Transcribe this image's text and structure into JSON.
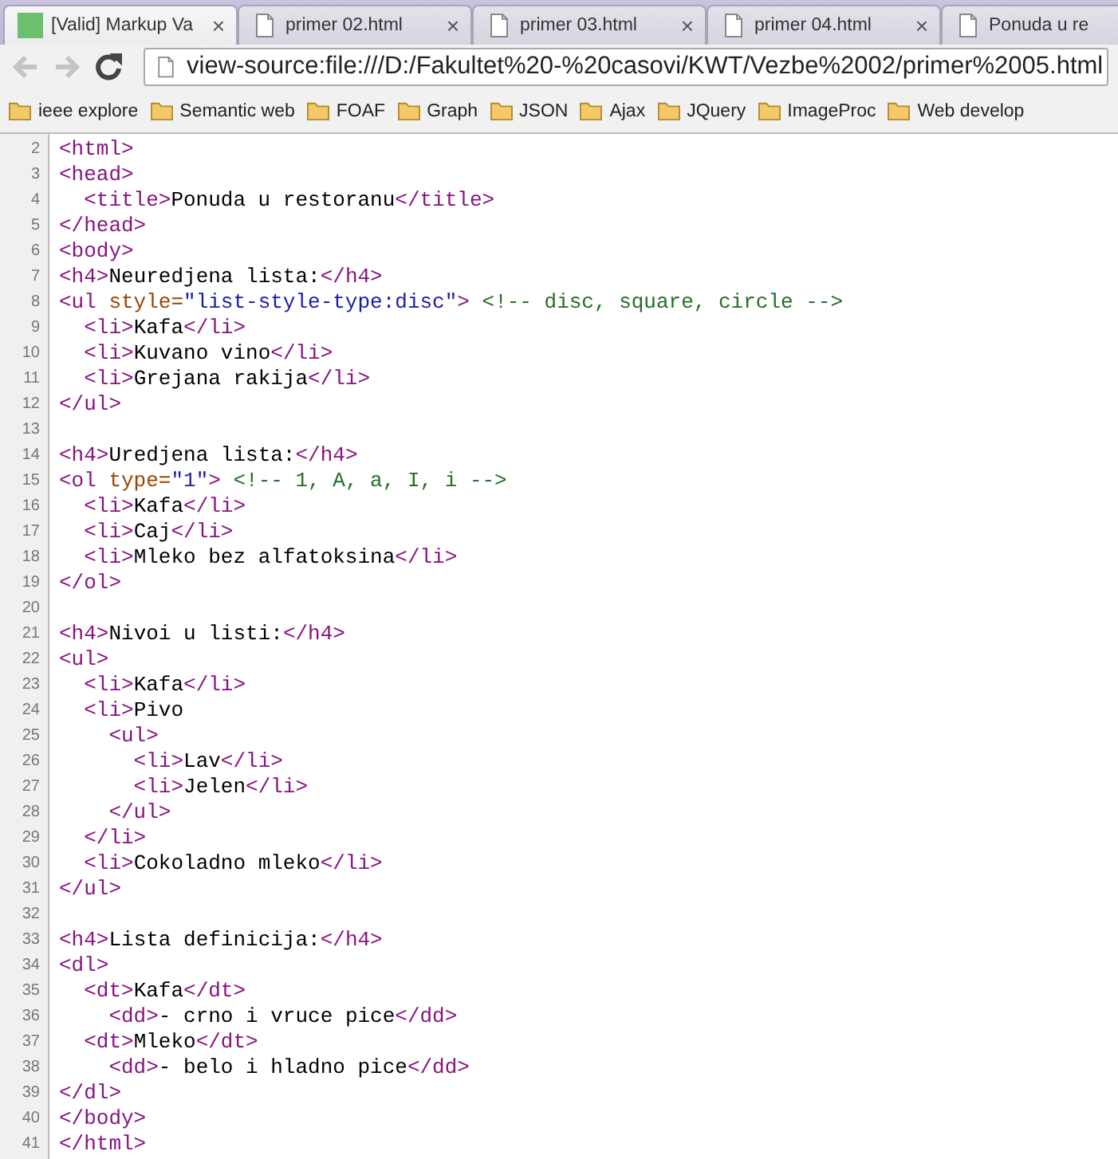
{
  "tabs": [
    {
      "title": "[Valid] Markup Va",
      "kind": "site",
      "close": "×",
      "selected": true
    },
    {
      "title": "primer 02.html",
      "kind": "file",
      "close": "×",
      "selected": false
    },
    {
      "title": "primer 03.html",
      "kind": "file",
      "close": "×",
      "selected": false
    },
    {
      "title": "primer 04.html",
      "kind": "file",
      "close": "×",
      "selected": false
    },
    {
      "title": "Ponuda u re",
      "kind": "file",
      "selected": false
    }
  ],
  "toolbar": {
    "address": "view-source:file:///D:/Fakultet%20-%20casovi/KWT/Vezbe%2002/primer%2005.html",
    "back_disabled": true,
    "forward_disabled": true
  },
  "bookmarks": [
    "ieee explore",
    "Semantic web",
    "FOAF",
    "Graph",
    "JSON",
    "Ajax",
    "JQuery",
    "ImageProc",
    "Web develop"
  ],
  "source_lines": [
    {
      "number": "2",
      "tokens": [
        {
          "kind": "tag",
          "text": "<html>"
        }
      ]
    },
    {
      "number": "3",
      "tokens": [
        {
          "kind": "tag",
          "text": "<head>"
        }
      ]
    },
    {
      "number": "4",
      "kind": "indented",
      "tokens": [
        {
          "kind": "tag",
          "text": "<title>"
        },
        {
          "kind": "text",
          "text": "Ponuda u restoranu"
        },
        {
          "kind": "tag",
          "text": "</title>"
        }
      ]
    },
    {
      "number": "5",
      "tokens": [
        {
          "kind": "tag",
          "text": "</head>"
        }
      ]
    },
    {
      "number": "6",
      "tokens": [
        {
          "kind": "tag",
          "text": "<body>"
        }
      ]
    },
    {
      "number": "7",
      "tokens": [
        {
          "kind": "tag",
          "text": "<h4>"
        },
        {
          "kind": "text",
          "text": "Neuredjena lista:"
        },
        {
          "kind": "tag",
          "text": "</h4>"
        }
      ]
    },
    {
      "number": "8",
      "tokens": [
        {
          "kind": "tag",
          "text": "<ul"
        },
        {
          "kind": "attr",
          "text": "style="
        },
        {
          "kind": "value",
          "text": "\"list-style-type:disc\""
        },
        {
          "kind": "tag",
          "text": ">"
        },
        {
          "kind": "comment",
          "text": "<!-- disc, square, circle -->"
        }
      ]
    },
    {
      "number": "9",
      "kind": "indented",
      "tokens": [
        {
          "kind": "tag",
          "text": "<li>"
        },
        {
          "kind": "text",
          "text": "Kafa"
        },
        {
          "kind": "tag",
          "text": "</li>"
        }
      ]
    },
    {
      "number": "10",
      "kind": "indented",
      "tokens": [
        {
          "kind": "tag",
          "text": "<li>"
        },
        {
          "kind": "text",
          "text": "Kuvano vino"
        },
        {
          "kind": "tag",
          "text": "</li>"
        }
      ]
    },
    {
      "number": "11",
      "kind": "indented",
      "tokens": [
        {
          "kind": "tag",
          "text": "<li>"
        },
        {
          "kind": "text",
          "text": "Grejana rakija"
        },
        {
          "kind": "tag",
          "text": "</li>"
        }
      ]
    },
    {
      "number": "12",
      "tokens": [
        {
          "kind": "tag",
          "text": "</ul>"
        }
      ]
    },
    {
      "number": "13"
    },
    {
      "number": "14",
      "tokens": [
        {
          "kind": "tag",
          "text": "<h4>"
        },
        {
          "kind": "text",
          "text": "Uredjena lista:"
        },
        {
          "kind": "tag",
          "text": "</h4>"
        }
      ]
    },
    {
      "number": "15",
      "tokens": [
        {
          "kind": "tag",
          "text": "<ol"
        },
        {
          "kind": "attr",
          "text": "type="
        },
        {
          "kind": "value",
          "text": "\"1\""
        },
        {
          "kind": "tag",
          "text": ">"
        },
        {
          "kind": "comment",
          "text": "<!-- 1, A, a, I, i -->"
        }
      ]
    },
    {
      "number": "16",
      "kind": "indented",
      "tokens": [
        {
          "kind": "tag",
          "text": "<li>"
        },
        {
          "kind": "text",
          "text": "Kafa"
        },
        {
          "kind": "tag",
          "text": "</li>"
        }
      ]
    },
    {
      "number": "17",
      "kind": "indented",
      "tokens": [
        {
          "kind": "tag",
          "text": "<li>"
        },
        {
          "kind": "text",
          "text": "Caj"
        },
        {
          "kind": "tag",
          "text": "</li>"
        }
      ]
    },
    {
      "number": "18",
      "kind": "indented",
      "tokens": [
        {
          "kind": "tag",
          "text": "<li>"
        },
        {
          "kind": "text",
          "text": "Mleko bez alfatoksina"
        },
        {
          "kind": "tag",
          "text": "</li>"
        }
      ]
    },
    {
      "number": "19",
      "tokens": [
        {
          "kind": "tag",
          "text": "</ol>"
        }
      ]
    },
    {
      "number": "20"
    },
    {
      "number": "21",
      "tokens": [
        {
          "kind": "tag",
          "text": "<h4>"
        },
        {
          "kind": "text",
          "text": "Nivoi u listi:"
        },
        {
          "kind": "tag",
          "text": "</h4>"
        }
      ]
    },
    {
      "number": "22",
      "tokens": [
        {
          "kind": "tag",
          "text": "<ul>"
        }
      ]
    },
    {
      "number": "23",
      "kind": "indented",
      "tokens": [
        {
          "kind": "tag",
          "text": "<li>"
        },
        {
          "kind": "text",
          "text": "Kafa"
        },
        {
          "kind": "tag",
          "text": "</li>"
        }
      ]
    },
    {
      "number": "24",
      "kind": "indented",
      "tokens": [
        {
          "kind": "tag",
          "text": "<li>"
        },
        {
          "kind": "text",
          "text": "Pivo"
        }
      ]
    },
    {
      "number": "25",
      "kind": "deeper",
      "tokens": [
        {
          "kind": "tag",
          "text": "<ul>"
        }
      ]
    },
    {
      "number": "26",
      "kind": "deepest",
      "tokens": [
        {
          "kind": "tag",
          "text": "<li>"
        },
        {
          "kind": "text",
          "text": "Lav"
        },
        {
          "kind": "tag",
          "text": "</li>"
        }
      ]
    },
    {
      "number": "27",
      "kind": "deepest",
      "tokens": [
        {
          "kind": "tag",
          "text": "<li>"
        },
        {
          "kind": "text",
          "text": "Jelen"
        },
        {
          "kind": "tag",
          "text": "</li>"
        }
      ]
    },
    {
      "number": "28",
      "kind": "deeper",
      "tokens": [
        {
          "kind": "tag",
          "text": "</ul>"
        }
      ]
    },
    {
      "number": "29",
      "kind": "indented",
      "tokens": [
        {
          "kind": "tag",
          "text": "</li>"
        }
      ]
    },
    {
      "number": "30",
      "kind": "indented",
      "tokens": [
        {
          "kind": "tag",
          "text": "<li>"
        },
        {
          "kind": "text",
          "text": "Cokoladno mleko"
        },
        {
          "kind": "tag",
          "text": "</li>"
        }
      ]
    },
    {
      "number": "31",
      "tokens": [
        {
          "kind": "tag",
          "text": "</ul>"
        }
      ]
    },
    {
      "number": "32"
    },
    {
      "number": "33",
      "tokens": [
        {
          "kind": "tag",
          "text": "<h4>"
        },
        {
          "kind": "text",
          "text": "Lista definicija:"
        },
        {
          "kind": "tag",
          "text": "</h4>"
        }
      ]
    },
    {
      "number": "34",
      "tokens": [
        {
          "kind": "tag",
          "text": "<dl>"
        }
      ]
    },
    {
      "number": "35",
      "kind": "indented",
      "tokens": [
        {
          "kind": "tag",
          "text": "<dt>"
        },
        {
          "kind": "text",
          "text": "Kafa"
        },
        {
          "kind": "tag",
          "text": "</dt>"
        }
      ]
    },
    {
      "number": "36",
      "kind": "deeper",
      "tokens": [
        {
          "kind": "tag",
          "text": "<dd>"
        },
        {
          "kind": "text",
          "text": "- crno i vruce pice"
        },
        {
          "kind": "tag",
          "text": "</dd>"
        }
      ]
    },
    {
      "number": "37",
      "kind": "indented",
      "tokens": [
        {
          "kind": "tag",
          "text": "<dt>"
        },
        {
          "kind": "text",
          "text": "Mleko"
        },
        {
          "kind": "tag",
          "text": "</dt>"
        }
      ]
    },
    {
      "number": "38",
      "kind": "deeper",
      "tokens": [
        {
          "kind": "tag",
          "text": "<dd>"
        },
        {
          "kind": "text",
          "text": "- belo i hladno pice"
        },
        {
          "kind": "tag",
          "text": "</dd>"
        }
      ]
    },
    {
      "number": "39",
      "tokens": [
        {
          "kind": "tag",
          "text": "</dl>"
        }
      ]
    },
    {
      "number": "40",
      "tokens": [
        {
          "kind": "tag",
          "text": "</body>"
        }
      ]
    },
    {
      "number": "41",
      "tokens": [
        {
          "kind": "tag",
          "text": "</html>"
        }
      ]
    }
  ]
}
